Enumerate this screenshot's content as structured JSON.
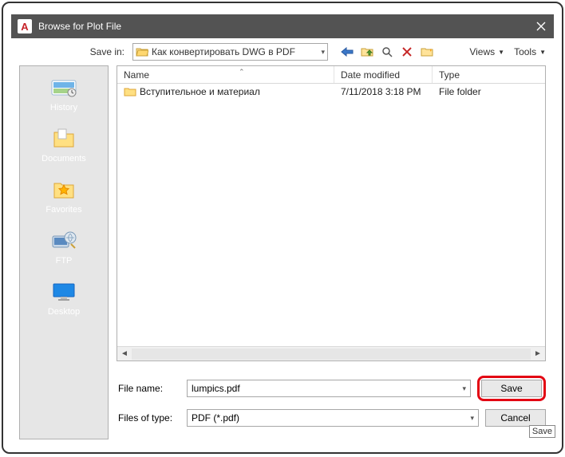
{
  "titlebar": {
    "title": "Browse for Plot File"
  },
  "toprow": {
    "save_in_label": "Save in:",
    "current_dir": "Как конвертировать DWG в PDF",
    "views_label": "Views",
    "tools_label": "Tools"
  },
  "sidebar": {
    "items": [
      {
        "label": "History"
      },
      {
        "label": "Documents"
      },
      {
        "label": "Favorites"
      },
      {
        "label": "FTP"
      },
      {
        "label": "Desktop"
      }
    ]
  },
  "columns": {
    "name": "Name",
    "date": "Date modified",
    "type": "Type"
  },
  "rows": [
    {
      "name": "Вступительное и материал",
      "date": "7/11/2018 3:18 PM",
      "type": "File folder"
    }
  ],
  "form": {
    "filename_label": "File name:",
    "filename_value": "lumpics.pdf",
    "type_label": "Files of type:",
    "type_value": "PDF (*.pdf)",
    "save_label": "Save",
    "cancel_label": "Cancel"
  },
  "tooltip": "Save"
}
